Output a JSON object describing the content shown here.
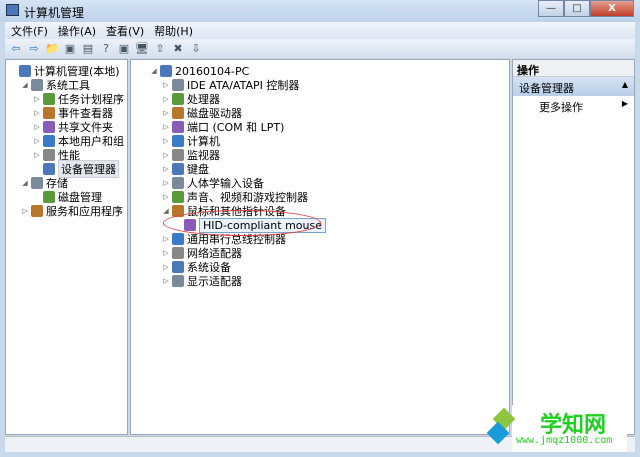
{
  "window": {
    "title": "计算机管理",
    "minimize": "—",
    "maximize": "□",
    "close": "X"
  },
  "menu": [
    "文件(F)",
    "操作(A)",
    "查看(V)",
    "帮助(H)"
  ],
  "toolbar": [
    "back",
    "forward",
    "up",
    "show-hide-tree",
    "properties",
    "help",
    "show-hide-action",
    "scan",
    "update-driver",
    "uninstall",
    "disable"
  ],
  "left_tree": [
    {
      "label": "计算机管理(本地)",
      "level": 0,
      "exp": "",
      "icon": "computer-management-icon"
    },
    {
      "label": "系统工具",
      "level": 1,
      "exp": "◢",
      "icon": "tools-icon"
    },
    {
      "label": "任务计划程序",
      "level": 2,
      "exp": "▷",
      "icon": "clock-icon"
    },
    {
      "label": "事件查看器",
      "level": 2,
      "exp": "▷",
      "icon": "event-viewer-icon"
    },
    {
      "label": "共享文件夹",
      "level": 2,
      "exp": "▷",
      "icon": "shared-folder-icon"
    },
    {
      "label": "本地用户和组",
      "level": 2,
      "exp": "▷",
      "icon": "users-icon"
    },
    {
      "label": "性能",
      "level": 2,
      "exp": "▷",
      "icon": "performance-icon"
    },
    {
      "label": "设备管理器",
      "level": 2,
      "exp": "",
      "icon": "device-manager-icon",
      "selected": true
    },
    {
      "label": "存储",
      "level": 1,
      "exp": "◢",
      "icon": "storage-icon"
    },
    {
      "label": "磁盘管理",
      "level": 2,
      "exp": "",
      "icon": "disk-management-icon"
    },
    {
      "label": "服务和应用程序",
      "level": 1,
      "exp": "▷",
      "icon": "services-icon"
    }
  ],
  "device_tree": [
    {
      "label": "20160104-PC",
      "level": 0,
      "exp": "◢",
      "icon": "pc-icon"
    },
    {
      "label": "IDE ATA/ATAPI 控制器",
      "level": 1,
      "exp": "▷",
      "icon": "ide-controller-icon"
    },
    {
      "label": "处理器",
      "level": 1,
      "exp": "▷",
      "icon": "processor-icon"
    },
    {
      "label": "磁盘驱动器",
      "level": 1,
      "exp": "▷",
      "icon": "disk-drive-icon"
    },
    {
      "label": "端口 (COM 和 LPT)",
      "level": 1,
      "exp": "▷",
      "icon": "port-icon"
    },
    {
      "label": "计算机",
      "level": 1,
      "exp": "▷",
      "icon": "computer-icon"
    },
    {
      "label": "监视器",
      "level": 1,
      "exp": "▷",
      "icon": "monitor-icon"
    },
    {
      "label": "键盘",
      "level": 1,
      "exp": "▷",
      "icon": "keyboard-icon"
    },
    {
      "label": "人体学输入设备",
      "level": 1,
      "exp": "▷",
      "icon": "hid-icon"
    },
    {
      "label": "声音、视频和游戏控制器",
      "level": 1,
      "exp": "▷",
      "icon": "sound-icon"
    },
    {
      "label": "鼠标和其他指针设备",
      "level": 1,
      "exp": "◢",
      "icon": "mouse-icon"
    },
    {
      "label": "HID-compliant mouse",
      "level": 2,
      "exp": "",
      "icon": "mouse-icon",
      "focused": true
    },
    {
      "label": "通用串行总线控制器",
      "level": 1,
      "exp": "▷",
      "icon": "usb-icon"
    },
    {
      "label": "网络适配器",
      "level": 1,
      "exp": "▷",
      "icon": "network-adapter-icon"
    },
    {
      "label": "系统设备",
      "level": 1,
      "exp": "▷",
      "icon": "system-device-icon"
    },
    {
      "label": "显示适配器",
      "level": 1,
      "exp": "▷",
      "icon": "display-adapter-icon"
    }
  ],
  "actions": {
    "header": "操作",
    "section": "设备管理器",
    "section_arrow": "▲",
    "more": "更多操作",
    "more_arrow": "▶"
  },
  "watermark": {
    "brand": "学知网",
    "url": "www.jmqz1000.com"
  }
}
